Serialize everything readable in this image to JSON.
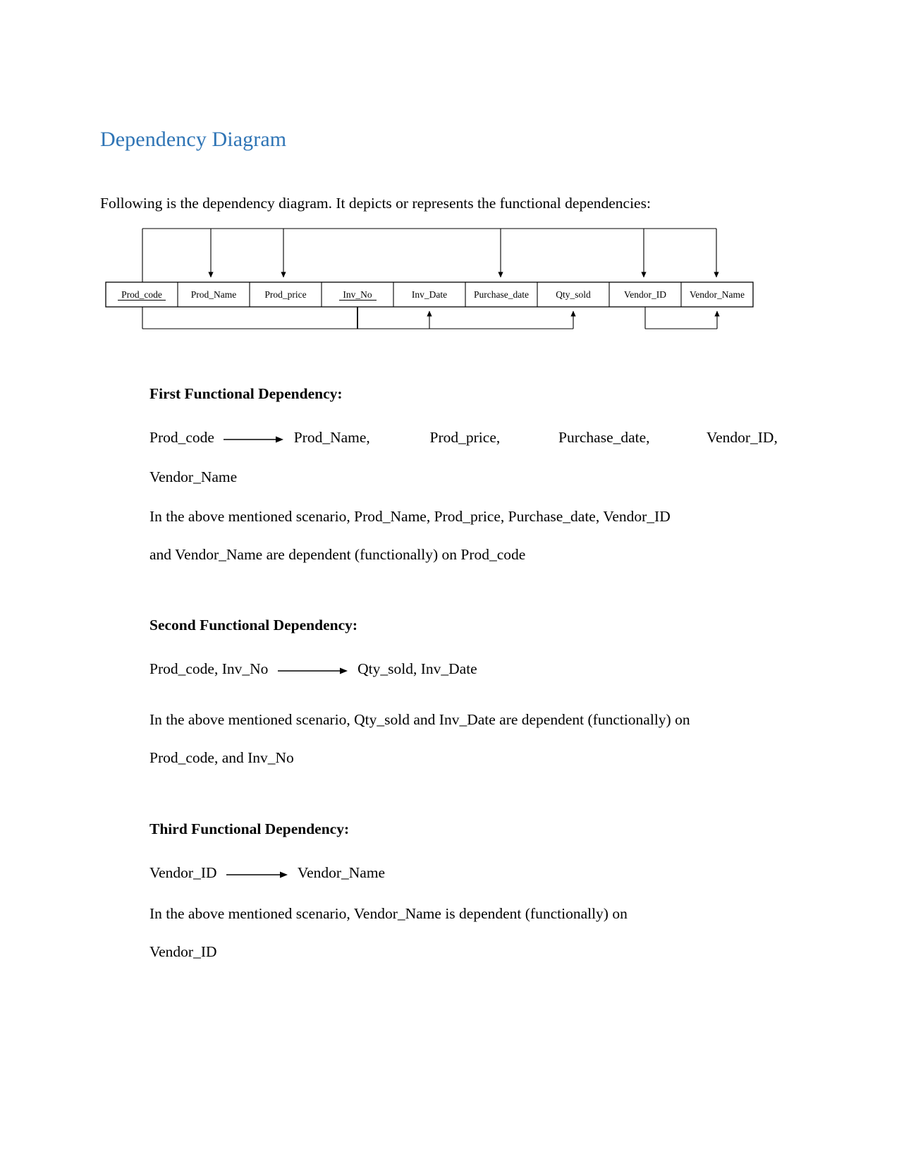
{
  "document": {
    "title": "Dependency Diagram",
    "title_color": "#2E74B5",
    "intro": "Following is the dependency diagram. It depicts or represents the functional dependencies:"
  },
  "diagram": {
    "type": "dependency-diagram",
    "attributes": [
      {
        "name": "Prod_code",
        "underlined": true
      },
      {
        "name": "Prod_Name",
        "underlined": false
      },
      {
        "name": "Prod_price",
        "underlined": false
      },
      {
        "name": "Inv_No",
        "underlined": true
      },
      {
        "name": "Inv_Date",
        "underlined": false
      },
      {
        "name": "Purchase_date",
        "underlined": false
      },
      {
        "name": "Qty_sold",
        "underlined": false
      },
      {
        "name": "Vendor_ID",
        "underlined": false
      },
      {
        "name": "Vendor_Name",
        "underlined": false
      }
    ],
    "top_dependencies": {
      "source": "Prod_code",
      "targets": [
        "Prod_Name",
        "Prod_price",
        "Purchase_date",
        "Vendor_ID",
        "Vendor_Name"
      ]
    },
    "bottom_dependencies": [
      {
        "sources": [
          "Prod_code",
          "Inv_No"
        ],
        "targets": [
          "Inv_Date",
          "Qty_sold"
        ]
      },
      {
        "sources": [
          "Vendor_ID"
        ],
        "targets": [
          "Vendor_Name"
        ]
      }
    ]
  },
  "sections": [
    {
      "heading": "First Functional Dependency:",
      "rule_left": "Prod_code",
      "rule_right_line1": "Prod_Name,",
      "rule_right_line1b": "Prod_price,",
      "rule_right_line1c": "Purchase_date,",
      "rule_right_line1d": "Vendor_ID,",
      "rule_right_line2": "Vendor_Name",
      "description_line1": "In the above mentioned scenario, Prod_Name, Prod_price, Purchase_date, Vendor_ID",
      "description_line2": "and Vendor_Name are dependent (functionally) on Prod_code"
    },
    {
      "heading": "Second Functional Dependency:",
      "rule_left": "Prod_code, Inv_No",
      "rule_right": "Qty_sold, Inv_Date",
      "description_line1": "In the above mentioned scenario, Qty_sold and Inv_Date are dependent (functionally) on",
      "description_line2": "Prod_code, and Inv_No"
    },
    {
      "heading": "Third Functional Dependency:",
      "rule_left": "Vendor_ID",
      "rule_right": "Vendor_Name",
      "description_line1": "In the above mentioned scenario, Vendor_Name is dependent (functionally) on",
      "description_line2": "Vendor_ID"
    }
  ]
}
